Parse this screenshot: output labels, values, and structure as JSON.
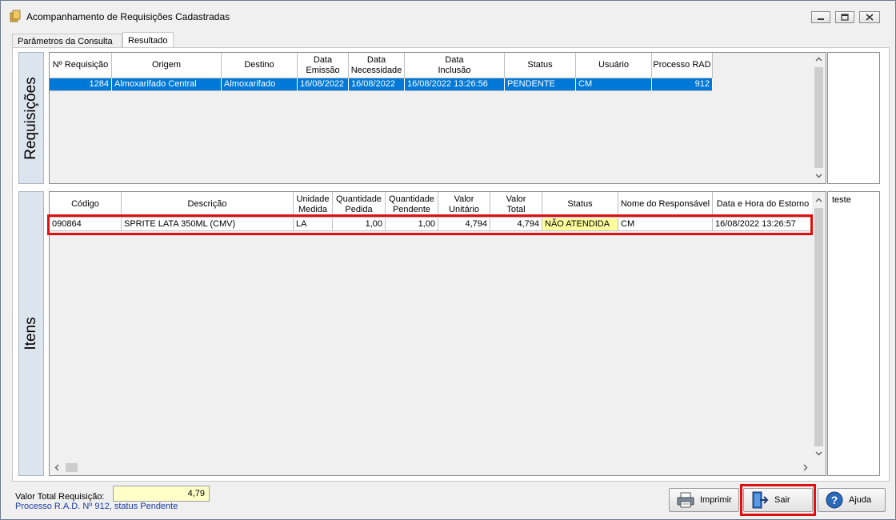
{
  "window": {
    "title": "Acompanhamento de Requisições Cadastradas"
  },
  "tabs": [
    {
      "label": "Parâmetros da Consulta",
      "active": false
    },
    {
      "label": "Resultado",
      "active": true
    }
  ],
  "requisicoes": {
    "side_label": "Requisições",
    "headers": [
      "Nº Requisição",
      "Origem",
      "Destino",
      "Data\nEmissão",
      "Data\nNecessidade",
      "Data\nInclusão",
      "Status",
      "Usuário",
      "Processo RAD"
    ],
    "rows": [
      [
        "1284",
        "Almoxarifado Central",
        "Almoxarifado",
        "16/08/2022",
        "16/08/2022",
        "16/08/2022 13:26:56",
        "PENDENTE",
        "CM",
        "912"
      ]
    ]
  },
  "itens": {
    "side_label": "Itens",
    "headers": [
      "Código",
      "Descrição",
      "Unidade\nMedida",
      "Quantidade\nPedida",
      "Quantidade\nPendente",
      "Valor\nUnitário",
      "Valor\nTotal",
      "Status",
      "Nome do Responsável",
      "Data e Hora do Estorno"
    ],
    "rows": [
      [
        "090864",
        "SPRITE LATA 350ML (CMV)",
        "LA",
        "1,00",
        "1,00",
        "4,794",
        "4,794",
        "NÃO ATENDIDA",
        "CM",
        "16/08/2022 13:26:57"
      ]
    ],
    "memo": "teste"
  },
  "footer": {
    "valor_total_label": "Valor Total Requisição:",
    "valor_total_value": "4,79",
    "status_text": "Processo R.A.D. Nº 912, status Pendente"
  },
  "buttons": {
    "imprimir": {
      "label": "Imprimir",
      "icon": "printer-icon"
    },
    "sair": {
      "label": "Sair",
      "icon": "exit-door-icon"
    },
    "ajuda": {
      "label": "Ajuda",
      "icon": "help-icon"
    }
  },
  "colors": {
    "selection": "#0078d7",
    "status_highlight": "#ffff9c",
    "highlight_box": "#e01010",
    "total_field": "#ffffc8"
  }
}
